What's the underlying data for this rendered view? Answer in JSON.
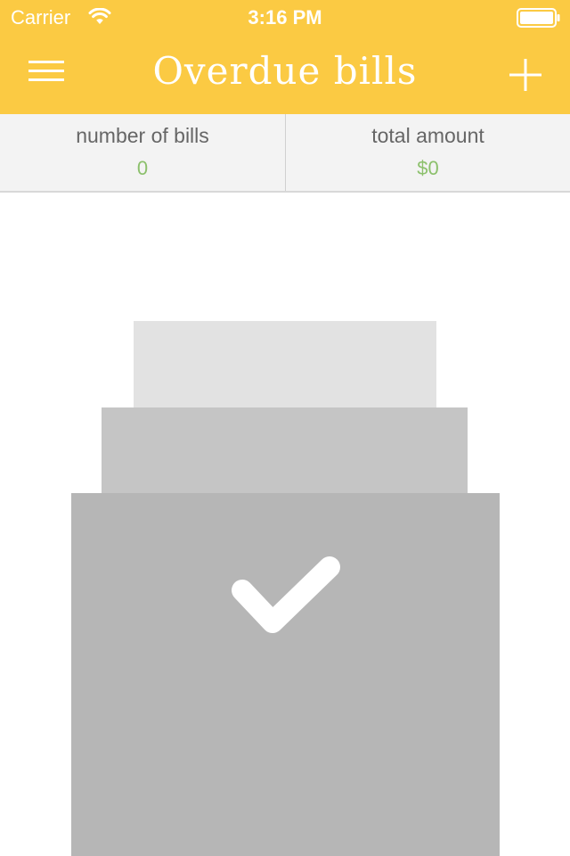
{
  "status_bar": {
    "carrier": "Carrier",
    "time": "3:16 PM",
    "wifi_icon": "wifi-icon",
    "battery_icon": "battery-icon"
  },
  "nav": {
    "title": "Overdue bills",
    "menu_icon": "hamburger-menu-icon",
    "add_icon": "plus-icon"
  },
  "summary": {
    "bills_label": "number of bills",
    "bills_value": "0",
    "amount_label": "total amount",
    "amount_value": "$0"
  },
  "empty_state": {
    "illustration": "stacked-bills-with-checkmark",
    "check_icon": "checkmark-icon"
  },
  "colors": {
    "header": "#fbca43",
    "summary_bg": "#f3f3f3",
    "value_green": "#8cc06c",
    "stack_light": "#e2e2e2",
    "stack_mid": "#c5c5c5",
    "stack_dark": "#b6b6b6"
  }
}
